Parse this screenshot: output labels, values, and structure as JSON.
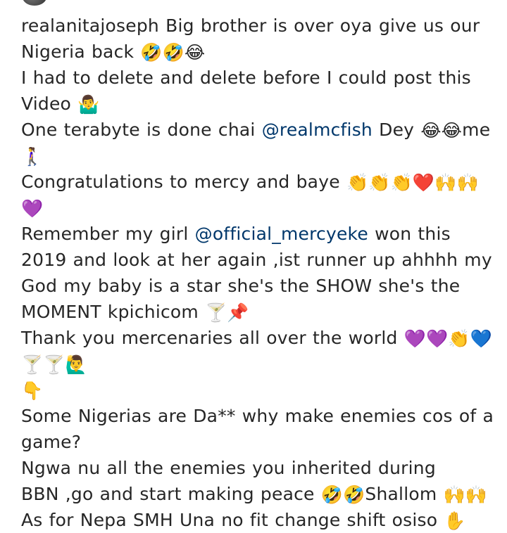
{
  "caption": {
    "lines": [
      {
        "text": "realanitajoseph Big brother is over oya give us our",
        "emoji": ""
      },
      {
        "text": "Nigeria back ",
        "emoji": "🤣🤣😂"
      },
      {
        "text": "I had to delete and delete before I could post this",
        "emoji": ""
      },
      {
        "text": "Video ",
        "emoji": "🤷‍♂️"
      },
      {
        "pre": "One terabyte is done chai ",
        "mention": "@realmcfish",
        "post": " Dey ",
        "emoji": "😂😂",
        "post2": "me"
      },
      {
        "text": "",
        "emoji": "🚶‍♀️"
      },
      {
        "text": "Congratulations to mercy and baye ",
        "emoji": "👏👏👏❤️🙌🙌"
      },
      {
        "text": "",
        "emoji": "💜"
      },
      {
        "pre": "Remember my girl ",
        "mention": "@official_mercyeke",
        "post": " won this",
        "emoji": "",
        "post2": ""
      },
      {
        "text": "2019 and look at her again ,ist runner up ahhhh my",
        "emoji": ""
      },
      {
        "text": "God my baby is a star she's the SHOW she's the",
        "emoji": ""
      },
      {
        "text": "MOMENT kpichicom ",
        "emoji": "🍸📌"
      },
      {
        "text": "Thank you mercenaries all over the world ",
        "emoji": "💜💜👏💙"
      },
      {
        "text": "",
        "emoji": "🍸🍸🙋‍♂️"
      },
      {
        "text": "",
        "emoji": "👇"
      },
      {
        "text": "Some Nigerias are Da** why make enemies cos of a",
        "emoji": ""
      },
      {
        "text": "game?",
        "emoji": ""
      },
      {
        "text": "Ngwa nu all the enemies you inherited during",
        "emoji": ""
      },
      {
        "text": "BBN ,go and start making peace ",
        "emoji": "🤣🤣",
        "tail": "Shallom ",
        "emoji2": "🙌🙌"
      },
      {
        "text": "As for Nepa SMH Una no fit change shift osiso ",
        "emoji": "✋"
      }
    ]
  }
}
